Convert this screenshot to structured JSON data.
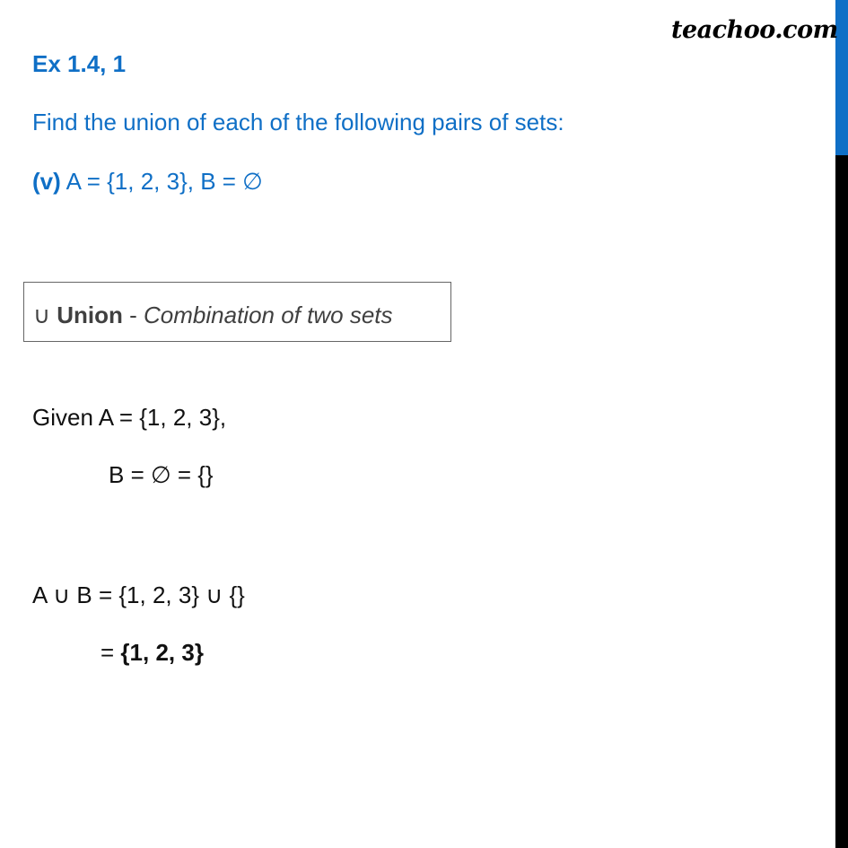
{
  "brand": {
    "logo_text": "teachoo.com",
    "accent_color": "#0f6fc6"
  },
  "header": {
    "exercise": "Ex 1.4, 1",
    "question": "Find the union of each of the following pairs of sets:",
    "part_label": "(v)",
    "part_text": " A = {1, 2, 3}, B = ∅"
  },
  "definition": {
    "symbol": "∪ ",
    "term": "Union",
    "separator": " - ",
    "description": "Combination of two sets"
  },
  "solution": {
    "given_a": "Given A = {1, 2, 3},",
    "given_b": "B = ∅ = {}",
    "step1": "A ∪ B = {1, 2, 3} ∪ {}",
    "step2_prefix": "= ",
    "answer": "{1, 2, 3}"
  }
}
